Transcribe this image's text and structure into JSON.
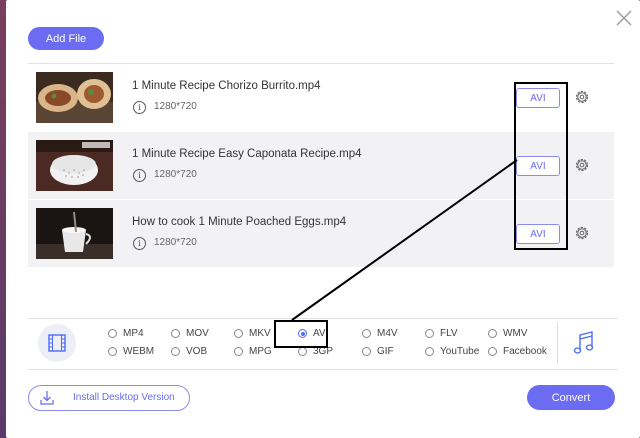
{
  "toolbar": {
    "add_file_label": "Add File"
  },
  "files": [
    {
      "name": "1 Minute Recipe Chorizo Burrito.mp4",
      "resolution": "1280*720",
      "format": "AVI"
    },
    {
      "name": "1 Minute Recipe Easy Caponata Recipe.mp4",
      "resolution": "1280*720",
      "format": "AVI"
    },
    {
      "name": "How to cook 1 Minute Poached Eggs.mp4",
      "resolution": "1280*720",
      "format": "AVI"
    }
  ],
  "info_glyph": "i",
  "formats": {
    "row1": [
      "MP4",
      "MOV",
      "MKV",
      "AVI",
      "M4V",
      "FLV",
      "WMV"
    ],
    "row2": [
      "WEBM",
      "VOB",
      "MPG",
      "3GP",
      "GIF",
      "YouTube",
      "Facebook"
    ],
    "selected": "AVI"
  },
  "footer": {
    "install_label": "Install Desktop Version",
    "convert_label": "Convert"
  },
  "colors": {
    "accent": "#6b6cf2",
    "row_alt": "#f2f2f4",
    "highlight": "#000000"
  },
  "icons": [
    "close-icon",
    "video-format-icon",
    "audio-format-icon",
    "gear-icon",
    "info-icon",
    "download-icon"
  ]
}
